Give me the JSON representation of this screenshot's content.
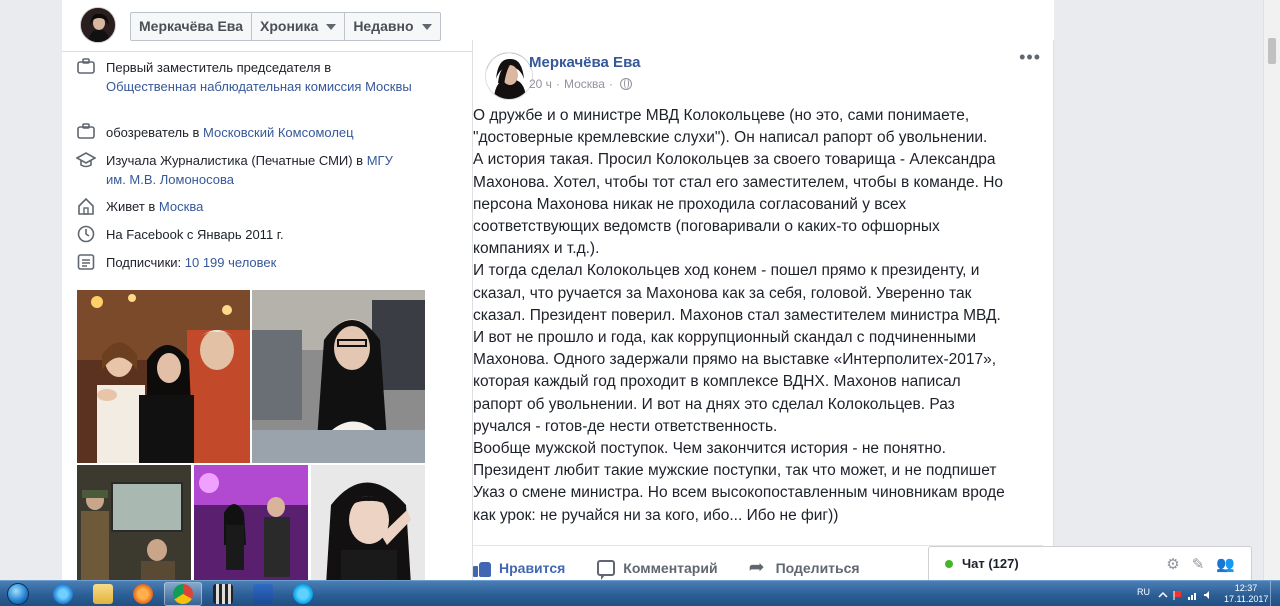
{
  "header": {
    "profile_name": "Меркачёва Ева",
    "timeline_label": "Хроника",
    "recent_label": "Недавно"
  },
  "intro": {
    "items": [
      {
        "icon": "briefcase-icon",
        "text": "Первый заместитель председателя в ",
        "link": "Общественная наблюдательная комиссия Москвы"
      },
      {
        "icon": "briefcase-icon",
        "text": "обозреватель в ",
        "link": "Московский Комсомолец"
      },
      {
        "icon": "graduation-cap-icon",
        "text": "Изучала Журналистика (Печатные СМИ) в ",
        "link": "МГУ им. М.В. Ломоносова"
      },
      {
        "icon": "home-icon",
        "text": "Живет в ",
        "link": "Москва"
      },
      {
        "icon": "clock-icon",
        "text": "На Facebook с Январь 2011 г.",
        "link": ""
      },
      {
        "icon": "followers-icon",
        "text": "Подписчики: ",
        "link": "10 199 человек"
      }
    ]
  },
  "post": {
    "author": "Меркачёва Ева",
    "time": "20 ч",
    "location": "Москва",
    "text": "О дружбе и о министре МВД Колокольцеве (но это, сами понимаете,\n\"достоверные кремлевские слухи\"). Он написал рапорт об увольнении.\nА история такая. Просил Колокольцев за своего товарища - Александра\nМахонова. Хотел, чтобы тот стал его заместителем, чтобы в команде. Но\nперсона Махонова никак не проходила согласований у всех\nсоответствующих ведомств (поговаривали о каких-то офшорных\nкомпаниях и т.д.).\nИ тогда сделал Колокольцев ход конем - пошел прямо к президенту, и\nсказал, что ручается за Махонова как за себя, головой. Уверенно так\nсказал. Президент поверил. Махонов стал заместителем министра МВД.\nИ вот не прошло и года, как коррупционный скандал с подчиненными\nМахонова. Одного задержали прямо на выставке «Интерполитех-2017»,\nкоторая каждый год проходит в комплексе ВДНХ. Махонов написал\nрапорт об увольнении. И вот на днях это сделал Колокольцев. Раз\nручался - готов-де нести ответственность.\nВообще мужской поступок. Чем закончится история - не понятно.\nПрезидент любит такие мужские поступки, так что может, и не подпишет\nУказ о смене министра. Но всем высокопоставленным чиновникам вроде\nкак урок: не ручайся ни за кого, ибо... Ибо не фиг))",
    "actions": {
      "like": "Нравится",
      "comment": "Комментарий",
      "share": "Поделиться"
    }
  },
  "chat": {
    "label": "Чат (127)"
  },
  "taskbar": {
    "language": "RU",
    "time": "12:37",
    "date": "17.11.2017"
  },
  "colors": {
    "link": "#365899",
    "like_blue": "#4267b2",
    "online_green": "#42b72a"
  }
}
